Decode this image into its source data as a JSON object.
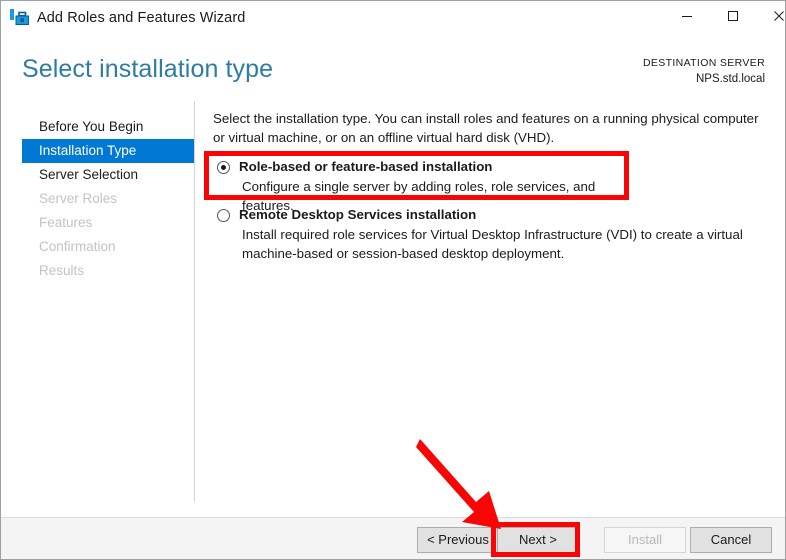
{
  "window": {
    "title": "Add Roles and Features Wizard",
    "icon": "wizard-toolbox-icon",
    "controls": {
      "minimize": "minimize-icon",
      "maximize": "maximize-icon",
      "close": "close-icon"
    }
  },
  "header": {
    "page_title": "Select installation type",
    "destination_label": "DESTINATION SERVER",
    "destination_value": "NPS.std.local"
  },
  "sidebar": {
    "items": [
      {
        "label": "Before You Begin",
        "state": "enabled"
      },
      {
        "label": "Installation Type",
        "state": "selected"
      },
      {
        "label": "Server Selection",
        "state": "enabled"
      },
      {
        "label": "Server Roles",
        "state": "disabled"
      },
      {
        "label": "Features",
        "state": "disabled"
      },
      {
        "label": "Confirmation",
        "state": "disabled"
      },
      {
        "label": "Results",
        "state": "disabled"
      }
    ]
  },
  "main": {
    "intro": "Select the installation type. You can install roles and features on a running physical computer or virtual machine, or on an offline virtual hard disk (VHD).",
    "options": [
      {
        "title": "Role-based or feature-based installation",
        "description": "Configure a single server by adding roles, role services, and features.",
        "selected": true
      },
      {
        "title": "Remote Desktop Services installation",
        "description": "Install required role services for Virtual Desktop Infrastructure (VDI) to create a virtual machine-based or session-based desktop deployment.",
        "selected": false
      }
    ]
  },
  "footer": {
    "buttons": [
      {
        "label": "< Previous",
        "state": "enabled"
      },
      {
        "label": "Next >",
        "state": "enabled"
      },
      {
        "label": "Install",
        "state": "disabled"
      },
      {
        "label": "Cancel",
        "state": "enabled"
      }
    ]
  },
  "annotations": {
    "accent_color": "#fa0505",
    "highlight_option_index": 0,
    "highlight_button_label": "Next >",
    "arrow": "red-arrow-pointing-to-next-button"
  },
  "colors": {
    "title_blue": "#2e7ba6",
    "selection_blue": "#0078d4",
    "text": "#1b1b1b",
    "disabled_text": "#c3c3c3",
    "footer_bg": "#f4f4f4",
    "button_bg": "#e1e1e1",
    "annotation_red": "#fa0505"
  }
}
